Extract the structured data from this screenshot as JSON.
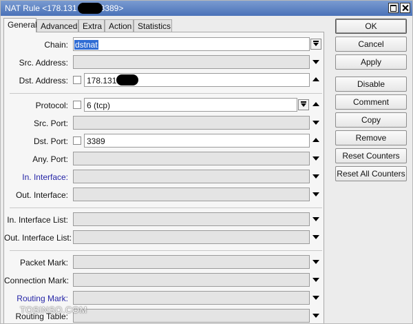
{
  "window": {
    "title_prefix": "NAT Rule <178.131",
    "title_suffix": "3389>"
  },
  "tabs": [
    "General",
    "Advanced",
    "Extra",
    "Action",
    "Statistics"
  ],
  "fields": {
    "chain": {
      "label": "Chain:",
      "value": "dstnat"
    },
    "src_address": {
      "label": "Src. Address:"
    },
    "dst_address": {
      "label": "Dst. Address:",
      "value": "178.131"
    },
    "protocol": {
      "label": "Protocol:",
      "value": "6 (tcp)"
    },
    "src_port": {
      "label": "Src. Port:"
    },
    "dst_port": {
      "label": "Dst. Port:",
      "value": "3389"
    },
    "any_port": {
      "label": "Any. Port:"
    },
    "in_interface": {
      "label": "In. Interface:"
    },
    "out_interface": {
      "label": "Out. Interface:"
    },
    "in_interface_list": {
      "label": "In. Interface List:"
    },
    "out_interface_list": {
      "label": "Out. Interface List:"
    },
    "packet_mark": {
      "label": "Packet Mark:"
    },
    "connection_mark": {
      "label": "Connection Mark:"
    },
    "routing_mark": {
      "label": "Routing Mark:"
    },
    "routing_table": {
      "label": "Routing Table:"
    }
  },
  "buttons": {
    "ok": "OK",
    "cancel": "Cancel",
    "apply": "Apply",
    "disable": "Disable",
    "comment": "Comment",
    "copy": "Copy",
    "remove": "Remove",
    "reset_counters": "Reset Counters",
    "reset_all_counters": "Reset All Counters"
  },
  "watermark": "TOSINSO.COM",
  "colors": {
    "titlebar": "#4a72b8",
    "selection": "#2f6cd4",
    "blue_label": "#2424a6"
  },
  "icons": {
    "dropdown": "dropdown-button-icon",
    "expand": "arrow-down-icon",
    "collapse": "arrow-up-icon"
  }
}
